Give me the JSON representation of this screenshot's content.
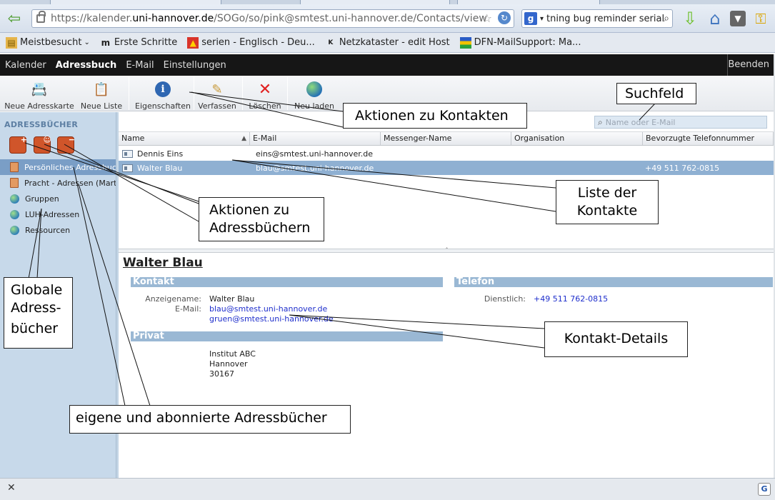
{
  "browser": {
    "url_prefix": "https://kalender.",
    "url_host": "uni-hannover.de",
    "url_path": "/SOGo/so/pink@smtest.uni-hannover.de/Contacts/view",
    "search_text": "tning bug reminder serial e",
    "bookmarks": [
      {
        "label": "Meistbesucht",
        "icon": "★"
      },
      {
        "label": "Erste Schritte",
        "icon": "m"
      },
      {
        "label": "serien - Englisch - Deu...",
        "icon": "▲"
      },
      {
        "label": "Netzkataster - edit Host",
        "icon": "K"
      },
      {
        "label": "DFN-MailSupport: Ma...",
        "icon": "■"
      }
    ]
  },
  "app": {
    "menu": {
      "calendar": "Kalender",
      "addressbook": "Adressbuch",
      "email": "E-Mail",
      "settings": "Einstellungen",
      "quit": "Beenden"
    },
    "toolbar": {
      "new_card": "Neue Adresskarte",
      "new_list": "Neue Liste",
      "properties": "Eigenschaften",
      "write": "Verfassen",
      "delete": "Löschen",
      "reload": "Neu laden"
    },
    "sidebar": {
      "title": "ADRESSBÜCHER",
      "books": [
        {
          "label": "Persönliches Adressbuch",
          "type": "book"
        },
        {
          "label": "Pracht - Adressen (Mart",
          "type": "book"
        },
        {
          "label": "Gruppen",
          "type": "globe"
        },
        {
          "label": "LUH-Adressen",
          "type": "globe"
        },
        {
          "label": "Ressourcen",
          "type": "globe"
        }
      ]
    },
    "search": {
      "placeholder": "Name oder E-Mail"
    },
    "columns": {
      "name": "Name",
      "email": "E-Mail",
      "messenger": "Messenger-Name",
      "organisation": "Organisation",
      "phone": "Bevorzugte Telefonnummer"
    },
    "contacts": [
      {
        "name": "Dennis Eins",
        "email": "eins@smtest.uni-hannover.de",
        "phone": ""
      },
      {
        "name": "Walter Blau",
        "email": "blau@smtest.uni-hannover.de",
        "phone": "+49 511 762-0815"
      }
    ],
    "detail": {
      "name": "Walter Blau",
      "section_contact": "Kontakt",
      "section_phone": "Telefon",
      "section_private": "Privat",
      "display_name_label": "Anzeigename:",
      "display_name": "Walter Blau",
      "email_label": "E-Mail:",
      "email1": "blau@smtest.uni-hannover.de",
      "email2": "gruen@smtest.uni-hannover.de",
      "office_label": "Dienstlich:",
      "office_phone": "+49 511 762-0815",
      "address_line1": "Institut ABC",
      "address_line2": "Hannover",
      "address_line3": "30167"
    }
  },
  "annotations": {
    "suchfeld": "Suchfeld",
    "aktionen_kontakte": "Aktionen zu Kontakten",
    "liste_line1": "Liste der",
    "liste_line2": "Kontakte",
    "aktionen_ab_line1": "Aktionen zu",
    "aktionen_ab_line2": "Adressbüchern",
    "globale_line1": "Globale",
    "globale_line2": "Adress-",
    "globale_line3": "bücher",
    "kontakt_details": "Kontakt-Details",
    "eigene": "eigene und abonnierte Adressbücher"
  }
}
